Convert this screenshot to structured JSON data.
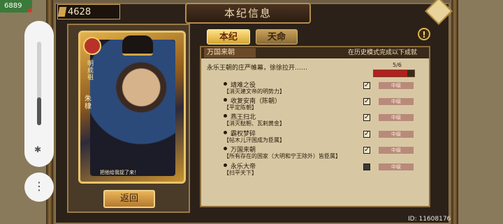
{
  "status": {
    "badge": "6889"
  },
  "currency": {
    "amount": "4628"
  },
  "header": {
    "title": "本纪信息"
  },
  "card": {
    "name": "朱棣",
    "side_title": "明成祖",
    "motto": "把他给我捉了来！"
  },
  "back_button": {
    "label": "返回"
  },
  "tabs": [
    {
      "label": "本纪"
    },
    {
      "label": "天命"
    }
  ],
  "panel": {
    "title": "万国来朝",
    "hint": "在历史模式完成以下成就",
    "description": "永乐王朝的庄严帷幕，徐徐拉开……",
    "progress_text": "5/6",
    "progress_value": 0.8333,
    "difficulty_label": "中级"
  },
  "achievements": [
    {
      "title": "靖难之役",
      "detail": "【消灭建文帝的明势力】",
      "done": true
    },
    {
      "title": "收复安南（陈朝）",
      "detail": "【平定陈朝】",
      "done": true
    },
    {
      "title": "燕王扫北",
      "detail": "【消灭鞑靼、瓦剌黄金】",
      "done": true
    },
    {
      "title": "霸权梦碎",
      "detail": "【帖木儿汗国成为臣属】",
      "done": true
    },
    {
      "title": "万国来朝",
      "detail": "【所有存在的国家（大明和宁王除外）皆臣属】",
      "done": true
    },
    {
      "title": "永乐大帝",
      "detail": "【扫平天下】",
      "done": false
    }
  ],
  "footer": {
    "id": "ID: 11608176"
  },
  "colors": {
    "progress": "#b31e1e",
    "panel_bg": "#d7c8a3",
    "frame": "#2b2118"
  }
}
